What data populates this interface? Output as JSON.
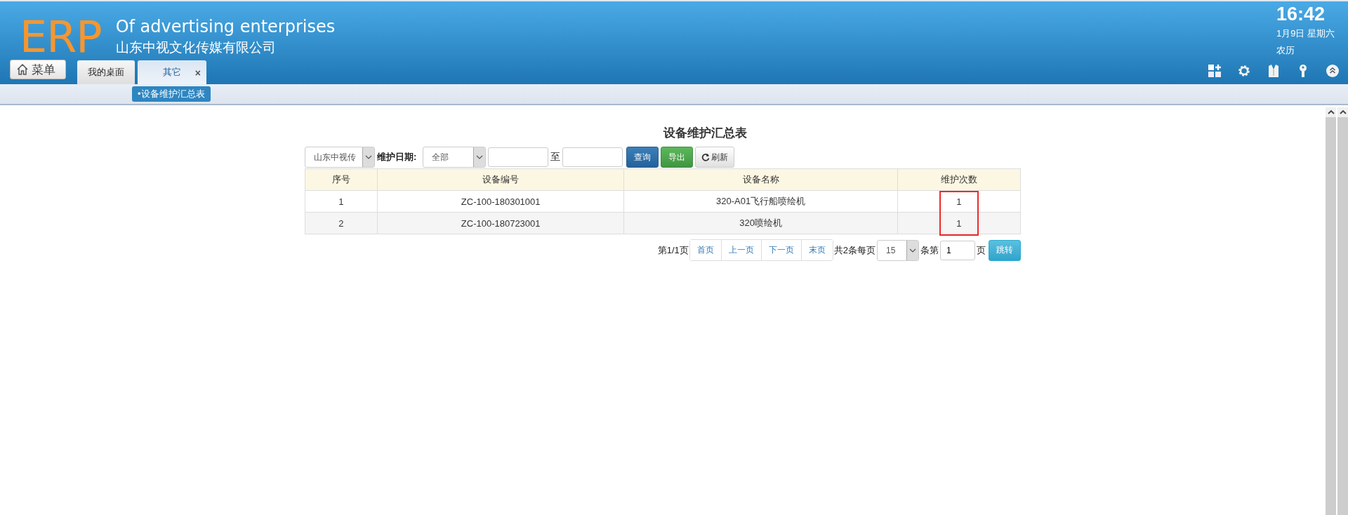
{
  "header": {
    "logo": "ERP",
    "title": "Of advertising enterprises",
    "subtitle": "山东中视文化传媒有限公司",
    "menu_button": "菜单",
    "tabs": [
      {
        "label": "我的桌面",
        "selected": false
      },
      {
        "label": "其它",
        "selected": true,
        "close": "×"
      }
    ],
    "clock": {
      "time": "16:42",
      "date": "1月9日 星期六",
      "lunar": "农历"
    }
  },
  "breadcrumb": [
    {
      "label": "•设备维护汇总表",
      "selected": true
    }
  ],
  "report": {
    "title": "设备维护汇总表",
    "filters": {
      "company": "山东中视传",
      "date_label": "维护日期:",
      "range": "全部",
      "separator": "至",
      "buttons": [
        {
          "kind": "primary",
          "label": "查询"
        },
        {
          "kind": "success",
          "label": "导出"
        },
        {
          "kind": "refresh",
          "label": "刷新"
        }
      ]
    },
    "table": {
      "columns": [
        {
          "label": "序号",
          "highlighted": false
        },
        {
          "label": "设备编号",
          "highlighted": false
        },
        {
          "label": "设备名称",
          "highlighted": false
        },
        {
          "label": "维护次数",
          "highlighted": true
        }
      ],
      "rows": [
        [
          "1",
          "ZC-100-180301001",
          "320-A01飞行船喷绘机",
          "1"
        ],
        [
          "2",
          "ZC-100-180723001",
          "320喷绘机",
          "1"
        ]
      ]
    },
    "pagination": {
      "page_info": "第1/1页",
      "links": [
        "首页",
        "上一页",
        "下一页",
        "末页"
      ],
      "total": "共2条每页",
      "page_size": "15",
      "goto_label": "条第",
      "goto_page": "1",
      "page_suffix": "页",
      "jump_button": "跳转"
    }
  }
}
